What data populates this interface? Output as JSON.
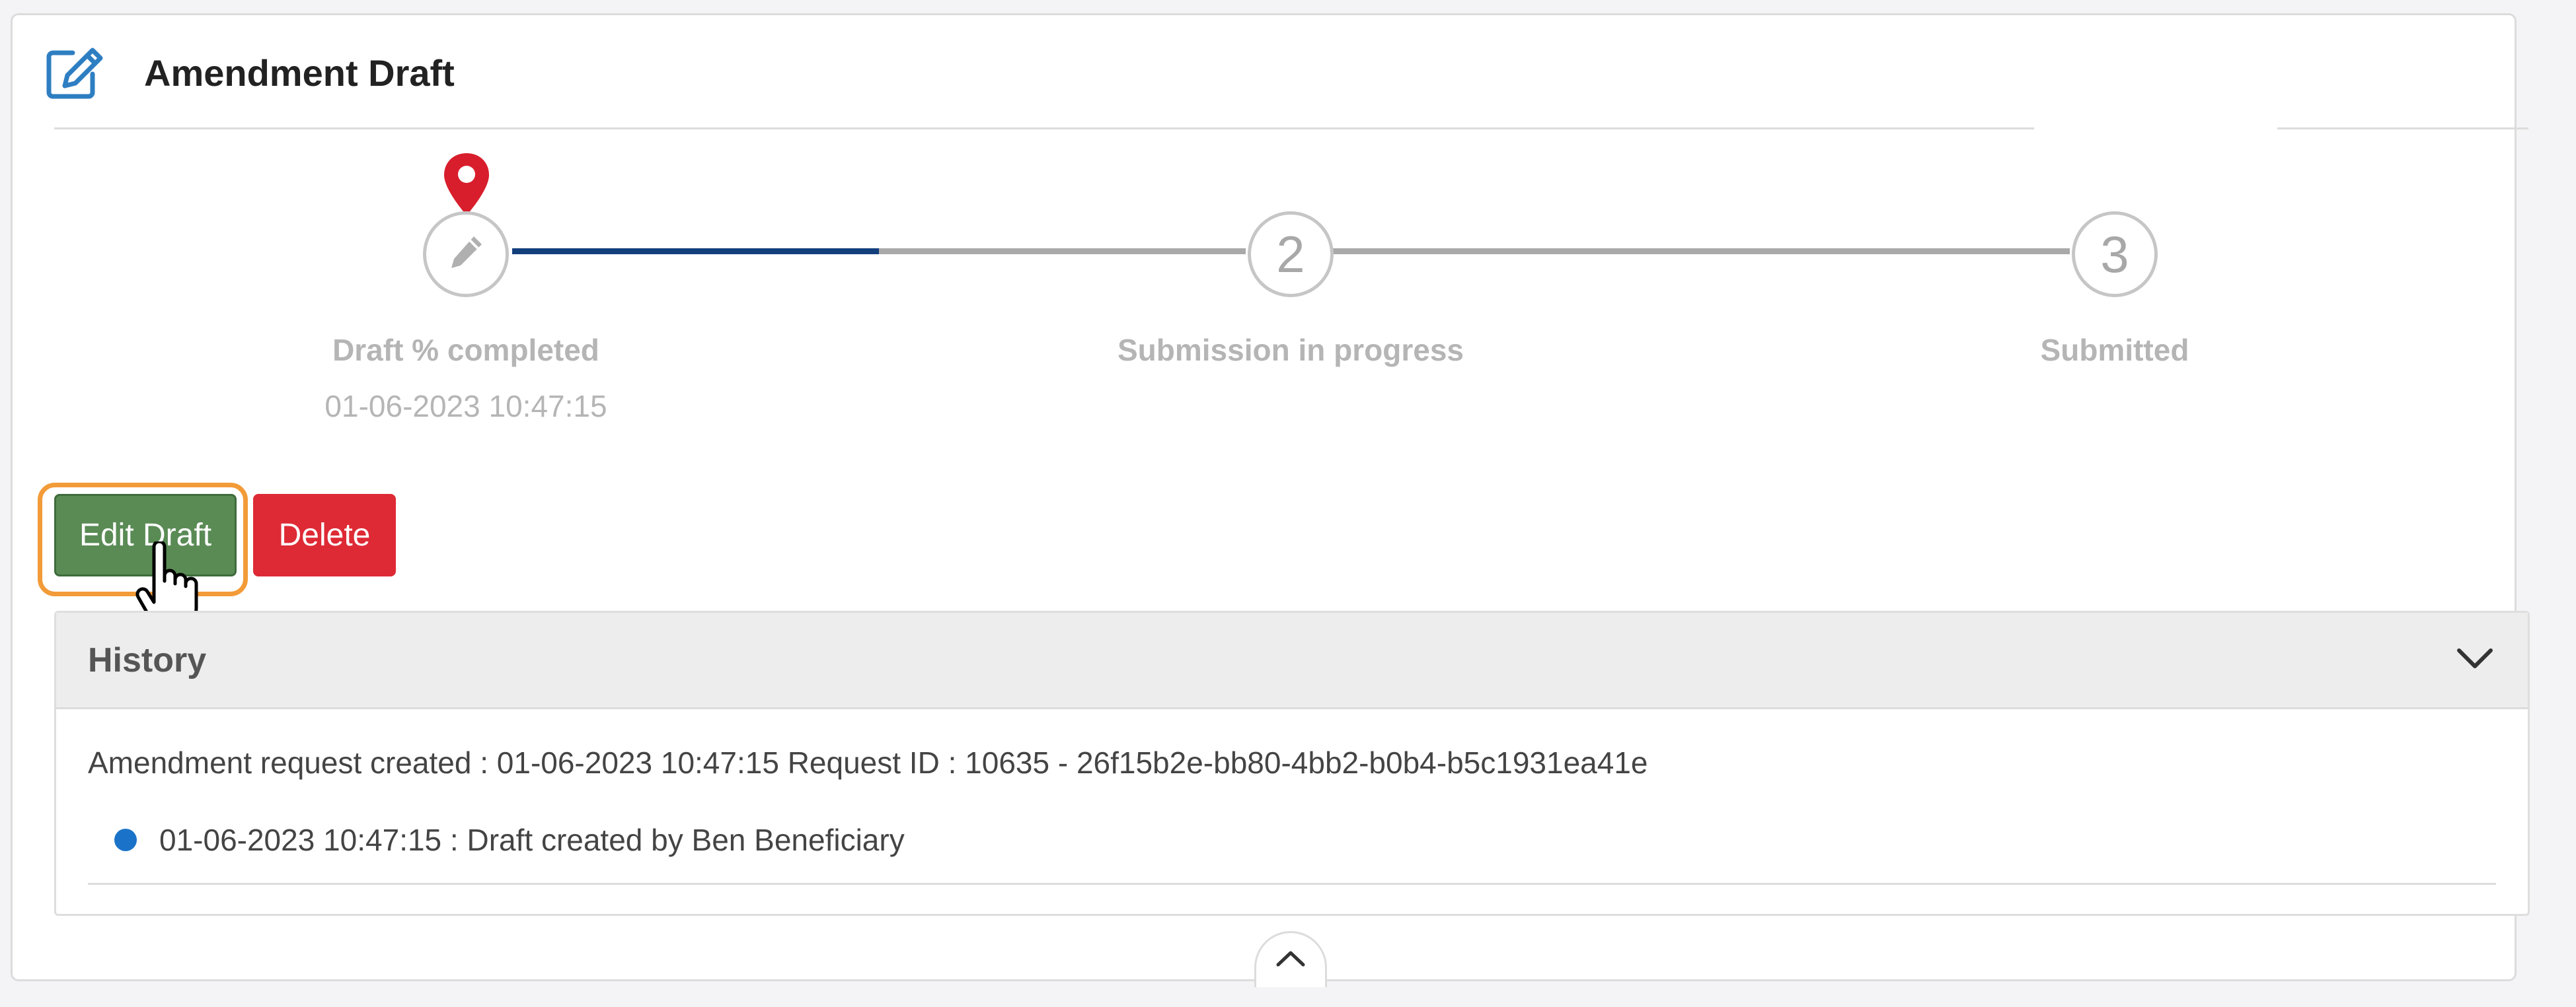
{
  "page": {
    "title": "Amendment Draft"
  },
  "stepper": {
    "steps": [
      {
        "label": "Draft % completed",
        "date": "01-06-2023 10:47:15",
        "icon": "pencil-icon",
        "state": "current"
      },
      {
        "label": "Submission in progress",
        "number": "2",
        "state": "pending"
      },
      {
        "label": "Submitted",
        "number": "3",
        "state": "pending"
      }
    ],
    "current_marker": "map-pin-icon",
    "colors": {
      "active_line": "#133f7c",
      "inactive_line": "#a9a9a9",
      "marker": "#d81e2c"
    }
  },
  "actions": {
    "edit_label": "Edit Draft",
    "delete_label": "Delete",
    "colors": {
      "edit": "#5a8b55",
      "delete": "#de2a35",
      "focus": "#f29b38"
    }
  },
  "history": {
    "title": "History",
    "summary": "Amendment request created : 01-06-2023 10:47:15 Request ID : 10635 - 26f15b2e-bb80-4bb2-b0b4-b5c1931ea41e",
    "entries": [
      {
        "text": "01-06-2023 10:47:15 : Draft created by Ben Beneficiary",
        "dot_color": "#1a73c8"
      }
    ]
  }
}
